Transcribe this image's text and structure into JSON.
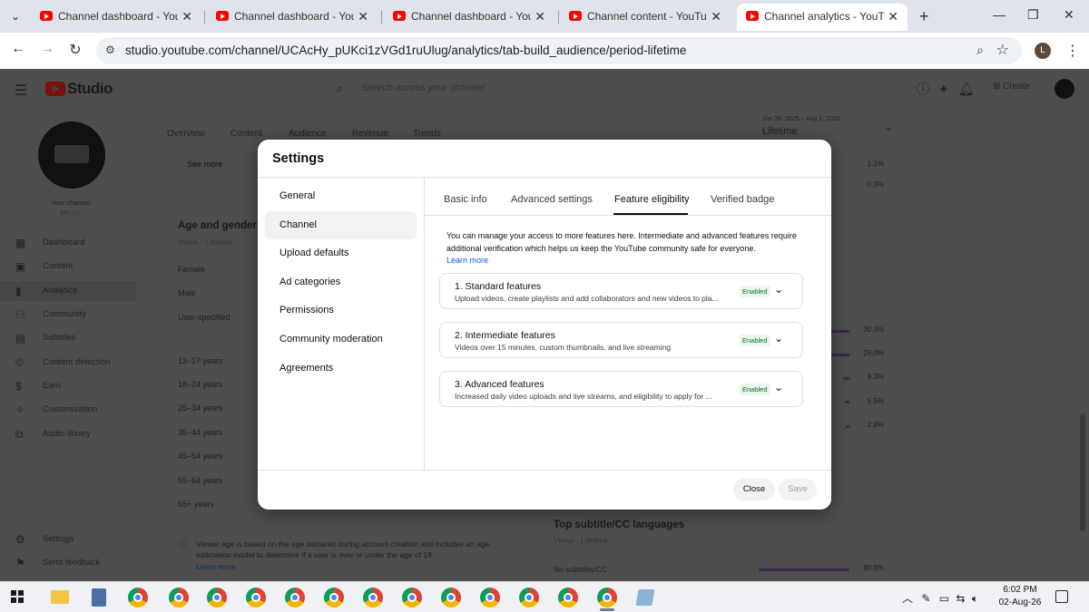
{
  "browser": {
    "tabs": [
      {
        "title": "Channel dashboard - YouTu",
        "active": false
      },
      {
        "title": "Channel dashboard - YouTu",
        "active": false
      },
      {
        "title": "Channel dashboard - YouTu",
        "active": false
      },
      {
        "title": "Channel content - YouTube",
        "active": false
      },
      {
        "title": "Channel analytics - YouTube",
        "active": true
      }
    ],
    "url": "studio.youtube.com/channel/UCAcHy_pUKci1zVGd1ruUlug/analytics/tab-build_audience/period-lifetime",
    "profile_initial": "L"
  },
  "studio": {
    "logo_text": "Studio",
    "search_placeholder": "Search across your channel",
    "create_label": "Create",
    "your_channel": "Your channel",
    "channel_name": "MM UY",
    "nav": [
      {
        "label": "Dashboard",
        "icon": "grid-icon"
      },
      {
        "label": "Content",
        "icon": "content-icon"
      },
      {
        "label": "Analytics",
        "icon": "analytics-icon"
      },
      {
        "label": "Community",
        "icon": "community-icon"
      },
      {
        "label": "Subtitles",
        "icon": "subtitles-icon"
      },
      {
        "label": "Content detection",
        "icon": "copyright-icon"
      },
      {
        "label": "Earn",
        "icon": "dollar-icon"
      },
      {
        "label": "Customization",
        "icon": "wand-icon"
      },
      {
        "label": "Audio library",
        "icon": "audio-library-icon"
      }
    ],
    "settings_label": "Settings",
    "feedback_label": "Send feedback",
    "analytics_tabs": [
      "Overview",
      "Content",
      "Audience",
      "Revenue",
      "Trends"
    ],
    "date_range": "Jun 28, 2025 – Aug 1, 2026",
    "period": "Lifetime",
    "see_more": "See more",
    "top_pcts": [
      "1.1%",
      "0.9%"
    ],
    "age_gender": {
      "title": "Age and gender",
      "subtitle": "Views · Lifetime",
      "genders": [
        "Female",
        "Male",
        "User-specified"
      ],
      "age_groups": [
        "13–17 years",
        "18–24 years",
        "25–34 years",
        "35–44 years",
        "45–54 years",
        "55–64 years",
        "65+ years"
      ],
      "age_pcts": [
        "30.3%",
        "26.0%",
        "8.3%",
        "5.5%",
        "2.8%"
      ],
      "age_values": [
        30.3,
        26.0,
        8.3,
        5.5,
        2.8
      ],
      "note": "Viewer age is based on the age declared during account creation and includes an age estimation model to determine if a user is over or under the age of 18",
      "learn_more": "Learn more"
    },
    "subtitles_card": {
      "title": "Top subtitle/CC languages",
      "subtitle": "Views · Lifetime",
      "row_label": "No subtitles/CC",
      "row_pct": "99.9%",
      "row_value": 99.9
    }
  },
  "modal": {
    "title": "Settings",
    "nav": [
      "General",
      "Channel",
      "Upload defaults",
      "Ad categories",
      "Permissions",
      "Community moderation",
      "Agreements"
    ],
    "selected_nav": "Channel",
    "tabs": [
      "Basic info",
      "Advanced settings",
      "Feature eligibility",
      "Verified badge"
    ],
    "selected_tab": "Feature eligibility",
    "intro": "You can manage your access to more features here. Intermediate and advanced features require additional verification which helps us keep the YouTube community safe for everyone.",
    "learn_more": "Learn more",
    "features": [
      {
        "title": "1. Standard features",
        "desc": "Upload videos, create playlists and add collaborators and new videos to pla...",
        "status": "Enabled"
      },
      {
        "title": "2. Intermediate features",
        "desc": "Videos over 15 minutes, custom thumbnails, and live streaming",
        "status": "Enabled"
      },
      {
        "title": "3. Advanced features",
        "desc": "Increased daily video uploads and live streams, and eligibility to apply for ...",
        "status": "Enabled"
      }
    ],
    "close_label": "Close",
    "save_label": "Save"
  },
  "taskbar": {
    "time": "6:02 PM",
    "date": "02-Aug-26"
  }
}
